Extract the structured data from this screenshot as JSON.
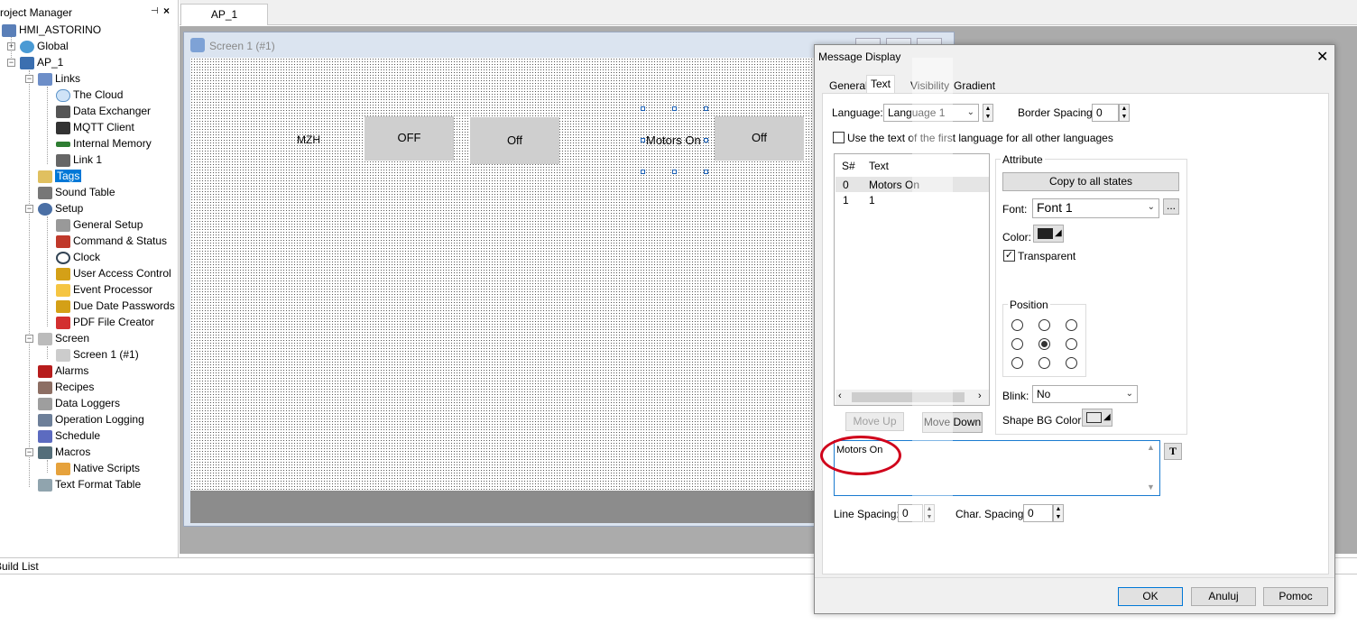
{
  "project_manager": {
    "title": "Project Manager",
    "tree": [
      {
        "label": "HMI_ASTORINO",
        "level": 0
      },
      {
        "label": "Global",
        "level": 1
      },
      {
        "label": "AP_1",
        "level": 1
      },
      {
        "label": "Links",
        "level": 2
      },
      {
        "label": "The Cloud",
        "level": 3
      },
      {
        "label": "Data Exchanger",
        "level": 3
      },
      {
        "label": "MQTT Client",
        "level": 3
      },
      {
        "label": "Internal Memory",
        "level": 3
      },
      {
        "label": "Link 1",
        "level": 3
      },
      {
        "label": "Tags",
        "level": 2,
        "selected": true
      },
      {
        "label": "Sound Table",
        "level": 2
      },
      {
        "label": "Setup",
        "level": 2
      },
      {
        "label": "General Setup",
        "level": 3
      },
      {
        "label": "Command & Status",
        "level": 3
      },
      {
        "label": "Clock",
        "level": 3
      },
      {
        "label": "User Access Control",
        "level": 3
      },
      {
        "label": "Event Processor",
        "level": 3
      },
      {
        "label": "Due Date Passwords",
        "level": 3
      },
      {
        "label": "PDF File Creator",
        "level": 3
      },
      {
        "label": "Screen",
        "level": 2
      },
      {
        "label": "Screen 1 (#1)",
        "level": 3
      },
      {
        "label": "Alarms",
        "level": 2
      },
      {
        "label": "Recipes",
        "level": 2
      },
      {
        "label": "Data Loggers",
        "level": 2
      },
      {
        "label": "Operation Logging",
        "level": 2
      },
      {
        "label": "Schedule",
        "level": 2
      },
      {
        "label": "Macros",
        "level": 2
      },
      {
        "label": "Native Scripts",
        "level": 3
      },
      {
        "label": "Text Format Table",
        "level": 2
      }
    ]
  },
  "editor": {
    "tab": "AP_1",
    "screen_title": "Screen 1 (#1)",
    "canvas": {
      "label_mzh": "MZH",
      "btn_off_1": "OFF",
      "btn_off_2": "Off",
      "message_text": "Motors On",
      "btn_off_3": "Off"
    }
  },
  "build_list": {
    "label": "Build List"
  },
  "dialog": {
    "title": "Message Display",
    "tabs": [
      "General",
      "Text",
      "Visibility",
      "Gradient"
    ],
    "active_tab": "Text",
    "language_label": "Language:",
    "language_value": "Language 1",
    "border_spacing_label": "Border Spacing:",
    "border_spacing_value": "0",
    "use_first_lang_label": "Use the text of the first language for all other languages",
    "list_headers": [
      "S#",
      "Text"
    ],
    "list_rows": [
      {
        "sn": "0",
        "text": "Motors On"
      },
      {
        "sn": "1",
        "text": "1"
      }
    ],
    "attribute_label": "Attribute",
    "copy_all_label": "Copy to all states",
    "font_label": "Font:",
    "font_value": "Font 1",
    "font_more": "...",
    "color_label": "Color:",
    "transparent_label": "Transparent",
    "position_label": "Position",
    "blink_label": "Blink:",
    "blink_value": "No",
    "shape_bg_label": "Shape BG Color:",
    "move_up_label": "Move Up",
    "move_down_label": "Move Down",
    "text_value": "Motors On",
    "text_btn": "T",
    "line_spacing_label": "Line Spacing:",
    "line_spacing_value": "0",
    "char_spacing_label": "Char. Spacing:",
    "char_spacing_value": "0",
    "ok_label": "OK",
    "cancel_label": "Anuluj",
    "help_label": "Pomoc"
  },
  "colors": {
    "selection": "#0078d7",
    "annotation_circle": "#d0021b",
    "focus_border": "#1a7bd0"
  }
}
